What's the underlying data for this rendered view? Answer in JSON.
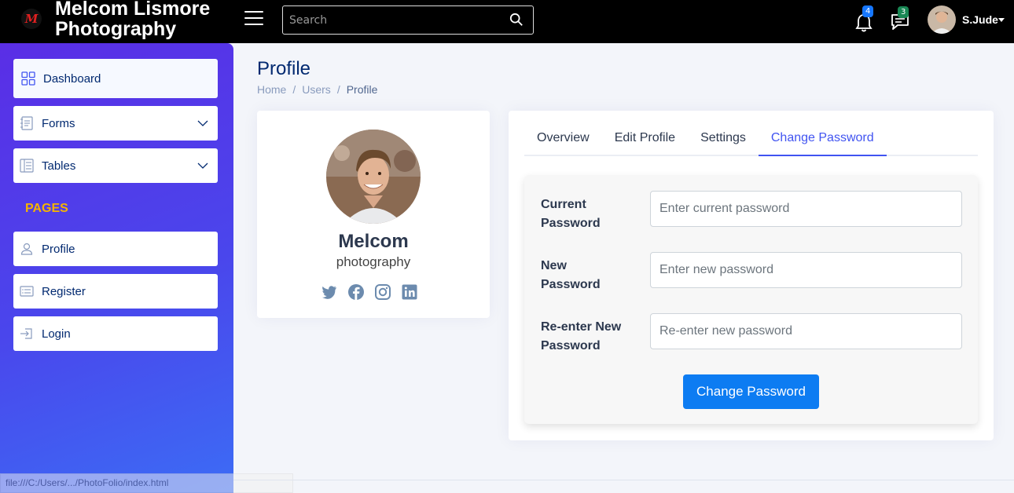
{
  "header": {
    "logo_letter": "M",
    "brand_line1": "Melcom Lismore",
    "brand_line2": "Photography",
    "search_placeholder": "Search",
    "notifications_count": "4",
    "messages_count": "3",
    "user_name": "S.Jude",
    "colors": {
      "notif_badge": "#1677ff",
      "msg_badge": "#198754"
    }
  },
  "sidebar": {
    "items": [
      {
        "label": "Dashboard",
        "icon": "grid-icon"
      },
      {
        "label": "Forms",
        "icon": "journal-text-icon"
      },
      {
        "label": "Tables",
        "icon": "layout-text-icon"
      }
    ],
    "pages_heading": "PAGES",
    "pages": [
      {
        "label": "Profile",
        "icon": "person-icon"
      },
      {
        "label": "Register",
        "icon": "card-list-icon"
      },
      {
        "label": "Login",
        "icon": "box-arrow-in-right-icon"
      }
    ],
    "status_url": "file:///C:/Users/.../PhotoFolio/index.html"
  },
  "main": {
    "title": "Profile",
    "breadcrumb": [
      "Home",
      "Users",
      "Profile"
    ],
    "profile": {
      "name": "Melcom",
      "role": "photography",
      "socials": [
        "twitter-icon",
        "facebook-icon",
        "instagram-icon",
        "linkedin-icon"
      ]
    },
    "tabs": [
      "Overview",
      "Edit Profile",
      "Settings",
      "Change Password"
    ],
    "active_tab": "Change Password",
    "form": {
      "current_label_1": "Current",
      "current_label_2": "Password",
      "current_placeholder": "Enter current password",
      "new_label_1": "New",
      "new_label_2": "Password",
      "new_placeholder": "Enter new password",
      "renew_label_1": "Re-enter New",
      "renew_label_2": "Password",
      "renew_placeholder": "Re-enter new password",
      "submit_label": "Change Password"
    }
  }
}
